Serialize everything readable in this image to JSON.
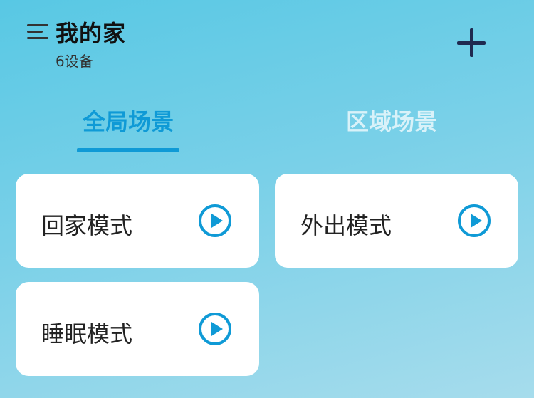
{
  "header": {
    "title": "我的家",
    "device_count": "6设备"
  },
  "tabs": [
    {
      "label": "全局场景",
      "active": true
    },
    {
      "label": "区域场景",
      "active": false
    }
  ],
  "scenes": [
    {
      "label": "回家模式"
    },
    {
      "label": "外出模式"
    },
    {
      "label": "睡眠模式"
    }
  ],
  "icons": {
    "menu": "menu-icon",
    "add": "plus-icon",
    "play": "play-circle-icon"
  },
  "colors": {
    "accent": "#0f9ad6",
    "inactive_tab": "#d9f2f9",
    "add_button": "#1f2a50"
  }
}
